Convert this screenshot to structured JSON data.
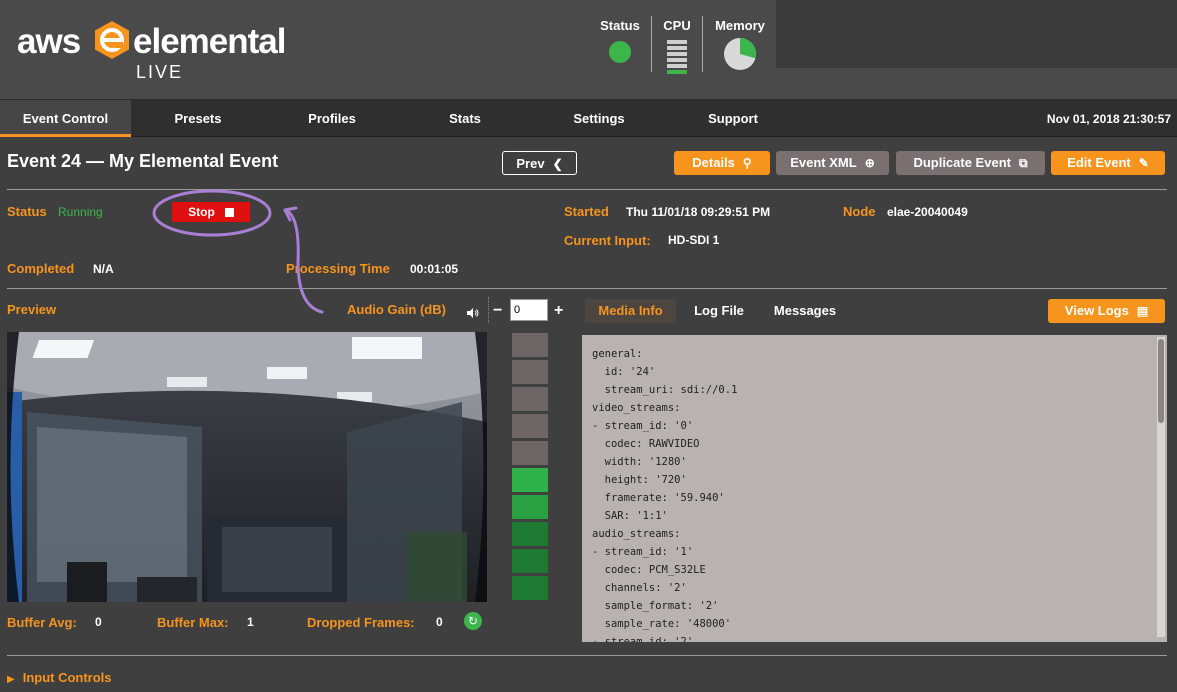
{
  "header": {
    "logo_aws": "aws",
    "logo_elemental": "elemental",
    "logo_live": "LIVE",
    "status_label": "Status",
    "cpu_label": "CPU",
    "memory_label": "Memory",
    "status_color": "#3cb54a",
    "memory_used_fraction": 0.3
  },
  "nav": {
    "tabs": [
      {
        "label": "Event Control"
      },
      {
        "label": "Presets"
      },
      {
        "label": "Profiles"
      },
      {
        "label": "Stats"
      },
      {
        "label": "Settings"
      },
      {
        "label": "Support"
      }
    ],
    "datetime": "Nov 01, 2018 21:30:57"
  },
  "event": {
    "title": "Event 24 — My Elemental Event",
    "prev_label": "Prev",
    "details_label": "Details",
    "event_xml_label": "Event XML",
    "duplicate_label": "Duplicate Event",
    "edit_label": "Edit Event"
  },
  "status": {
    "status_label": "Status",
    "status_value": "Running",
    "stop_label": "Stop",
    "started_label": "Started",
    "started_value": "Thu 11/01/18 09:29:51 PM",
    "node_label": "Node",
    "node_value": "elae-20040049",
    "current_input_label": "Current Input:",
    "current_input_value": "HD-SDI 1",
    "completed_label": "Completed",
    "completed_value": "N/A",
    "processing_label": "Processing Time",
    "processing_value": "00:01:05"
  },
  "preview": {
    "preview_label": "Preview",
    "audio_gain_label": "Audio Gain (dB)",
    "audio_gain_value": "0",
    "minus": "−",
    "plus": "+",
    "buffer_avg_label": "Buffer Avg:",
    "buffer_avg_value": "0",
    "buffer_max_label": "Buffer Max:",
    "buffer_max_value": "1",
    "dropped_frames_label": "Dropped Frames:",
    "dropped_frames_value": "0"
  },
  "media": {
    "tabs": [
      {
        "label": "Media Info"
      },
      {
        "label": "Log File"
      },
      {
        "label": "Messages"
      }
    ],
    "view_logs_label": "View Logs",
    "lines": [
      "general:",
      "  id: '24'",
      "  stream_uri: sdi://0.1",
      "video_streams:",
      "- stream_id: '0'",
      "  codec: RAWVIDEO",
      "  width: '1280'",
      "  height: '720'",
      "  framerate: '59.940'",
      "  SAR: '1:1'",
      "audio_streams:",
      "- stream_id: '1'",
      "  codec: PCM_S32LE",
      "  channels: '2'",
      "  sample_format: '2'",
      "  sample_rate: '48000'",
      "- stream_id: '2'"
    ]
  },
  "footer": {
    "input_controls_label": "Input Controls"
  }
}
